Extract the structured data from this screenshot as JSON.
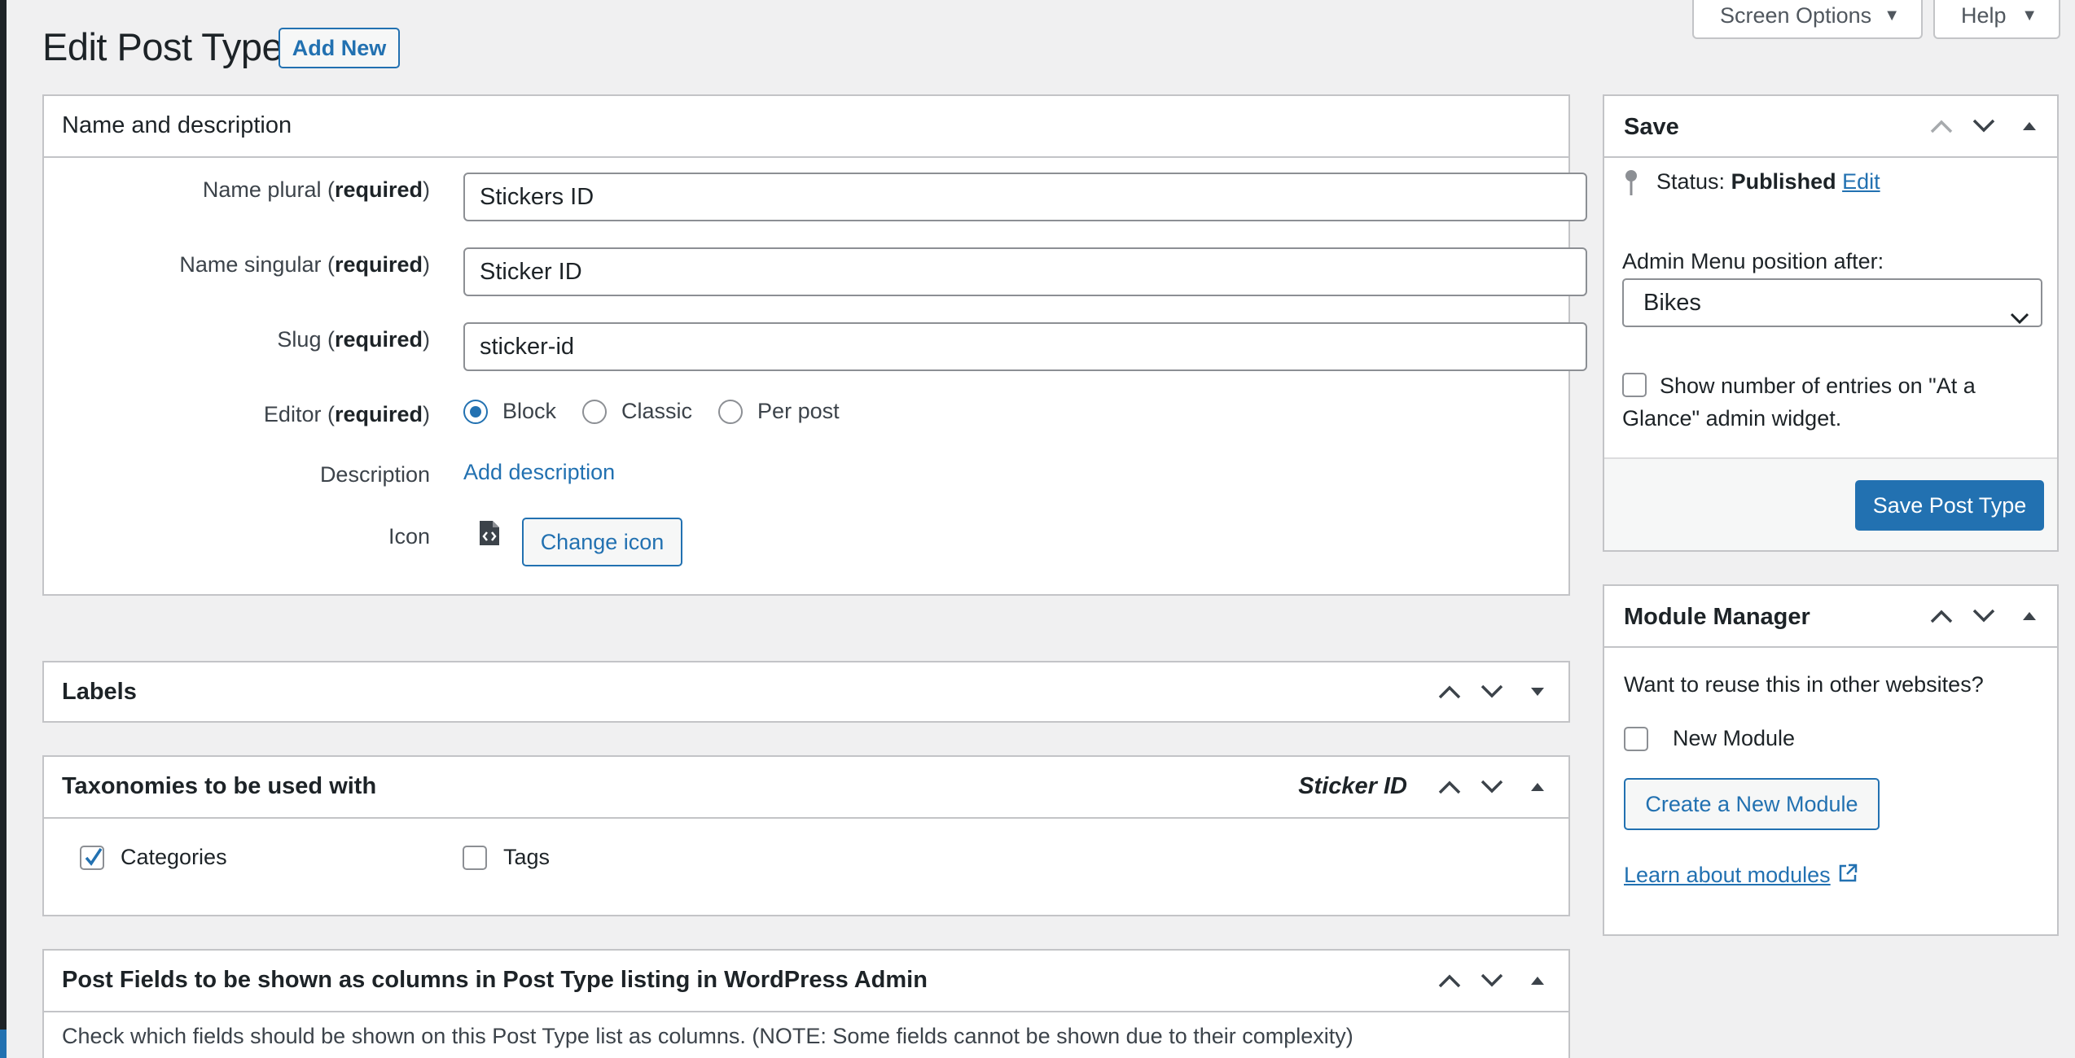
{
  "header": {
    "title": "Edit Post Type",
    "add_new": "Add New",
    "screen_options": "Screen Options",
    "help": "Help"
  },
  "name_desc": {
    "title": "Name and description",
    "name_plural_label": "Name plural",
    "name_singular_label": "Name singular",
    "slug_label": "Slug",
    "editor_label": "Editor",
    "required": "required",
    "name_plural_value": "Stickers ID",
    "name_singular_value": "Sticker ID",
    "slug_value": "sticker-id",
    "editor_options": [
      "Block",
      "Classic",
      "Per post"
    ],
    "editor_selected": "Block",
    "description_label": "Description",
    "add_description": "Add description",
    "icon_label": "Icon",
    "change_icon": "Change icon"
  },
  "labels_panel": {
    "title": "Labels"
  },
  "taxonomies_panel": {
    "title": "Taxonomies to be used with",
    "post_type_name": "Sticker ID",
    "items": [
      {
        "label": "Categories",
        "checked": true
      },
      {
        "label": "Tags",
        "checked": false
      }
    ]
  },
  "post_fields_panel": {
    "title": "Post Fields to be shown as columns in Post Type listing in WordPress Admin",
    "description": "Check which fields should be shown on this Post Type list as columns. (NOTE: Some fields cannot be shown due to their complexity)"
  },
  "save_panel": {
    "title": "Save",
    "status_label": "Status:",
    "status_value": "Published",
    "status_edit": "Edit",
    "menu_position_label": "Admin Menu position after:",
    "menu_position_value": "Bikes",
    "glance_label": "Show number of entries on \"At a Glance\" admin widget.",
    "save_button": "Save Post Type"
  },
  "module_panel": {
    "title": "Module Manager",
    "question": "Want to reuse this in other websites?",
    "new_module": "New Module",
    "create_button": "Create a New Module",
    "learn_link": "Learn about modules"
  },
  "colors": {
    "accent": "#2271b1",
    "background": "#f0f0f1",
    "border": "#c3c4c7"
  }
}
